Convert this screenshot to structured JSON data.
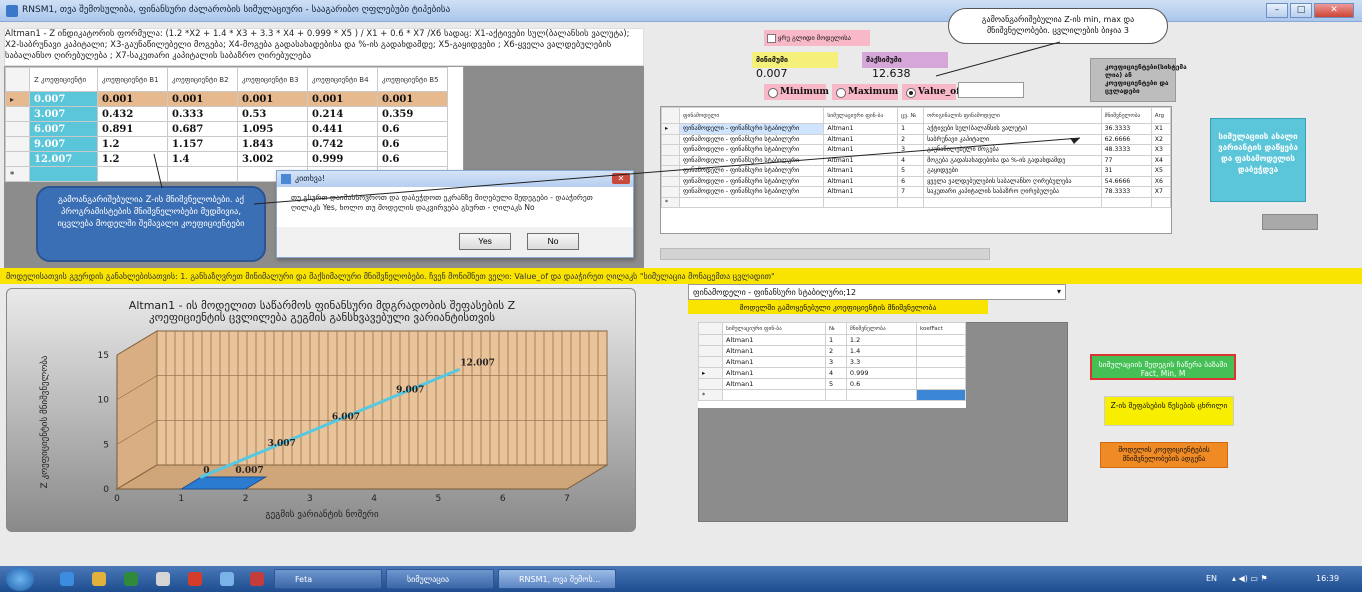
{
  "window": {
    "title": "RNSM1, თვა შემოსულიბა, ფინანსური ძალარობის სიმულაციური - სააგარიბო ღფლებუბი ტიპებისა",
    "min_label": "–",
    "max_label": "□",
    "close_label": "✕"
  },
  "formula": "Altman1 - Z ინდიკატორის ფორმულა: (1.2 *X2 + 1.4 * X3 + 3.3 * X4 + 0.999 * X5 ) / X1 + 0.6 * X7 /X6 სადაც: X1-აქტივები სულ(ბალანსის ვალუტა); X2-საბრუნავი კაპიტალი; X3-გაუნაწილებელი მოგება; X4-მოგება გადასახადებისა და %-ის გადახდამდე; X5-გაყიდვები ; X6-ყველა ვალდებულების საბალანსო ღირებულება ; X7-საკუთარი კაპიტალის საბაზრო ღირებულება",
  "grid1": {
    "headers": [
      "Z კოეფიციენტი",
      "კოეფიციენტი B1",
      "კოეფიციენტი B2",
      "კოეფიციენტი B3",
      "კოეფიციენტი B4",
      "კოეფიციენტი B5"
    ],
    "rows": [
      [
        "0.007",
        "0.001",
        "0.001",
        "0.001",
        "0.001",
        "0.001"
      ],
      [
        "3.007",
        "0.432",
        "0.333",
        "0.53",
        "0.214",
        "0.359"
      ],
      [
        "6.007",
        "0.891",
        "0.687",
        "1.095",
        "0.441",
        "0.6"
      ],
      [
        "9.007",
        "1.2",
        "1.157",
        "1.843",
        "0.742",
        "0.6"
      ],
      [
        "12.007",
        "1.2",
        "1.4",
        "3.002",
        "0.999",
        "0.6"
      ]
    ],
    "row_marker": "▸",
    "new_row_marker": "*"
  },
  "callout_left": "გამოანგარიშებულია Z-ის მნიშვნელობები. აქ პროგრამისტების მნიშვნელობები მუდმივია, იცვლება მოდელში შემავალი კოეფიციენტები",
  "dialog": {
    "title": "კითხვა!",
    "message": "თუ გსურთ დაიმახსოვროთ და დაბეჭდოთ ეკრანზე მიღებული შედეგები - დააჭირეთ ღილაკს Yes, ხოლო თუ მოდელის დაკვირვება გსურთ - ღილაკს No",
    "yes_label": "Yes",
    "no_label": "No"
  },
  "top_controls": {
    "checkbox_label": "ყრუ გლიდი მოდელისა",
    "min_label": "მინიმუმი",
    "max_label": "მაქსიმუმი",
    "min_value": "0.007",
    "max_value": "12.638",
    "callout": "გამოანგარიშებულია Z-ის min, max და მნიშვნელობები. ცვლილების ბიჯია 3",
    "radio_min": "Minimum",
    "radio_max": "Maximum",
    "radio_value": "Value_of:",
    "group_label": "კოეფიციენტები(სისტემა ლია) ან კოეფიციენტები და ცვლადები"
  },
  "grid2": {
    "headers": [
      "ფინამოდელი",
      "სიმულაციური ფინ-ბა",
      "ცვ. №",
      "ორიგინალის ფინამოდელი",
      "მნიშვნელობა",
      "Arg"
    ],
    "rows": [
      [
        "ფინამოდელი - ფინანსური სტაბილური",
        "Altman1",
        "1",
        "აქტივები სულ(ბალანსის ვალუტა)",
        "36.3333",
        "X1"
      ],
      [
        "ფინამოდელი - ფინანსური სტაბილური",
        "Altman1",
        "2",
        "საბრუნავი კაპიტალი",
        "62.6666",
        "X2"
      ],
      [
        "ფინამოდელი - ფინანსური სტაბილური",
        "Altman1",
        "3",
        "გაუნაწილებელი მოგება",
        "48.3333",
        "X3"
      ],
      [
        "ფინამოდელი - ფინანსური სტაბილური",
        "Altman1",
        "4",
        "მოგება გადასახადებისა და %-ის გადახდამდე",
        "77",
        "X4"
      ],
      [
        "ფინამოდელი - ფინანსური სტაბილური",
        "Altman1",
        "5",
        "გაყიდვები",
        "31",
        "X5"
      ],
      [
        "ფინამოდელი - ფინანსური სტაბილური",
        "Altman1",
        "6",
        "ყველა ვალდებულების საბალანსო ღირებულება",
        "54.6666",
        "X6"
      ],
      [
        "ფინამოდელი - ფინანსური სტაბილური",
        "Altman1",
        "7",
        "საკუთარი კაპიტალის საბაზრო ღირებულება",
        "78.3333",
        "X7"
      ]
    ]
  },
  "btn_cyan": "სიმულაციის ახალი ვარიანტის დაწყება და ფასამოდელის დაბეჭდვა",
  "strip": "მოდელისათვის გვერდის განახლებისათვის: 1. განსაზღვრეთ მინიმალური და მაქსიმალური მნიშვნელობები. ჩვენ მონიშნეთ ველი: Value_of და დააჭირეთ ღილაკს \"სიმულაცია მონაცემთა ცვლადით\"",
  "chart_data": {
    "type": "bar",
    "title": "Altman1 - ის მოდელით საწარმოს ფინანსური მდგრადობის შეფასების Z კოეფიციენტის ცვლილება გეგმის განსხვავებული ვარიანტისთვის",
    "xlabel": "გეგმის ვარიანტის ნომერი",
    "ylabel": "Z კოეფიციენტის მნიშვნელობა",
    "x": [
      1,
      2,
      3,
      4,
      5
    ],
    "values": [
      0.007,
      3.007,
      6.007,
      9.007,
      12.007
    ],
    "value_labels": [
      "0",
      "0.007",
      "3.007",
      "6.007",
      "9.007",
      "12.007"
    ],
    "xlim": [
      0,
      7
    ],
    "ylim": [
      0,
      15
    ],
    "xticks": [
      "0",
      "1",
      "2",
      "3",
      "4",
      "5",
      "6",
      "7"
    ],
    "yticks": [
      "0",
      "5",
      "10",
      "15"
    ],
    "grid": true
  },
  "combo": {
    "value": "ფინამოდელი - ფინანსური სტაბილური;12",
    "banner": "მოდელში გამოყენებული კოეფიციენტის მნიშვნელობა",
    "arrow": "▾"
  },
  "grid3": {
    "headers": [
      "სიმულაციური ფინ-ბა",
      "№",
      "მნიშვნელობა",
      "koefFact"
    ],
    "rows": [
      [
        "Altman1",
        "1",
        "1.2",
        ""
      ],
      [
        "Altman1",
        "2",
        "1.4",
        ""
      ],
      [
        "Altman1",
        "3",
        "3.3",
        ""
      ],
      [
        "Altman1",
        "4",
        "0.999",
        ""
      ],
      [
        "Altman1",
        "5",
        "0.6",
        ""
      ]
    ]
  },
  "btn_green": "სიმულაციის შედეგის ჩაწერა ბაზაში Fact, Min, M",
  "btn_yellow": "Z-ის შეფასების წესების ცხრილი",
  "btn_orange": "მოდელის კოეფიციენტების მნიშვნელობების ადგენა",
  "taskbar": {
    "tasks": [
      "Feta",
      "სიმულაცია",
      "RNSM1, თვა შემოს..."
    ],
    "lang": "EN",
    "tray": "▴ ◀) ▭ ⚑",
    "clock": "16:39"
  }
}
